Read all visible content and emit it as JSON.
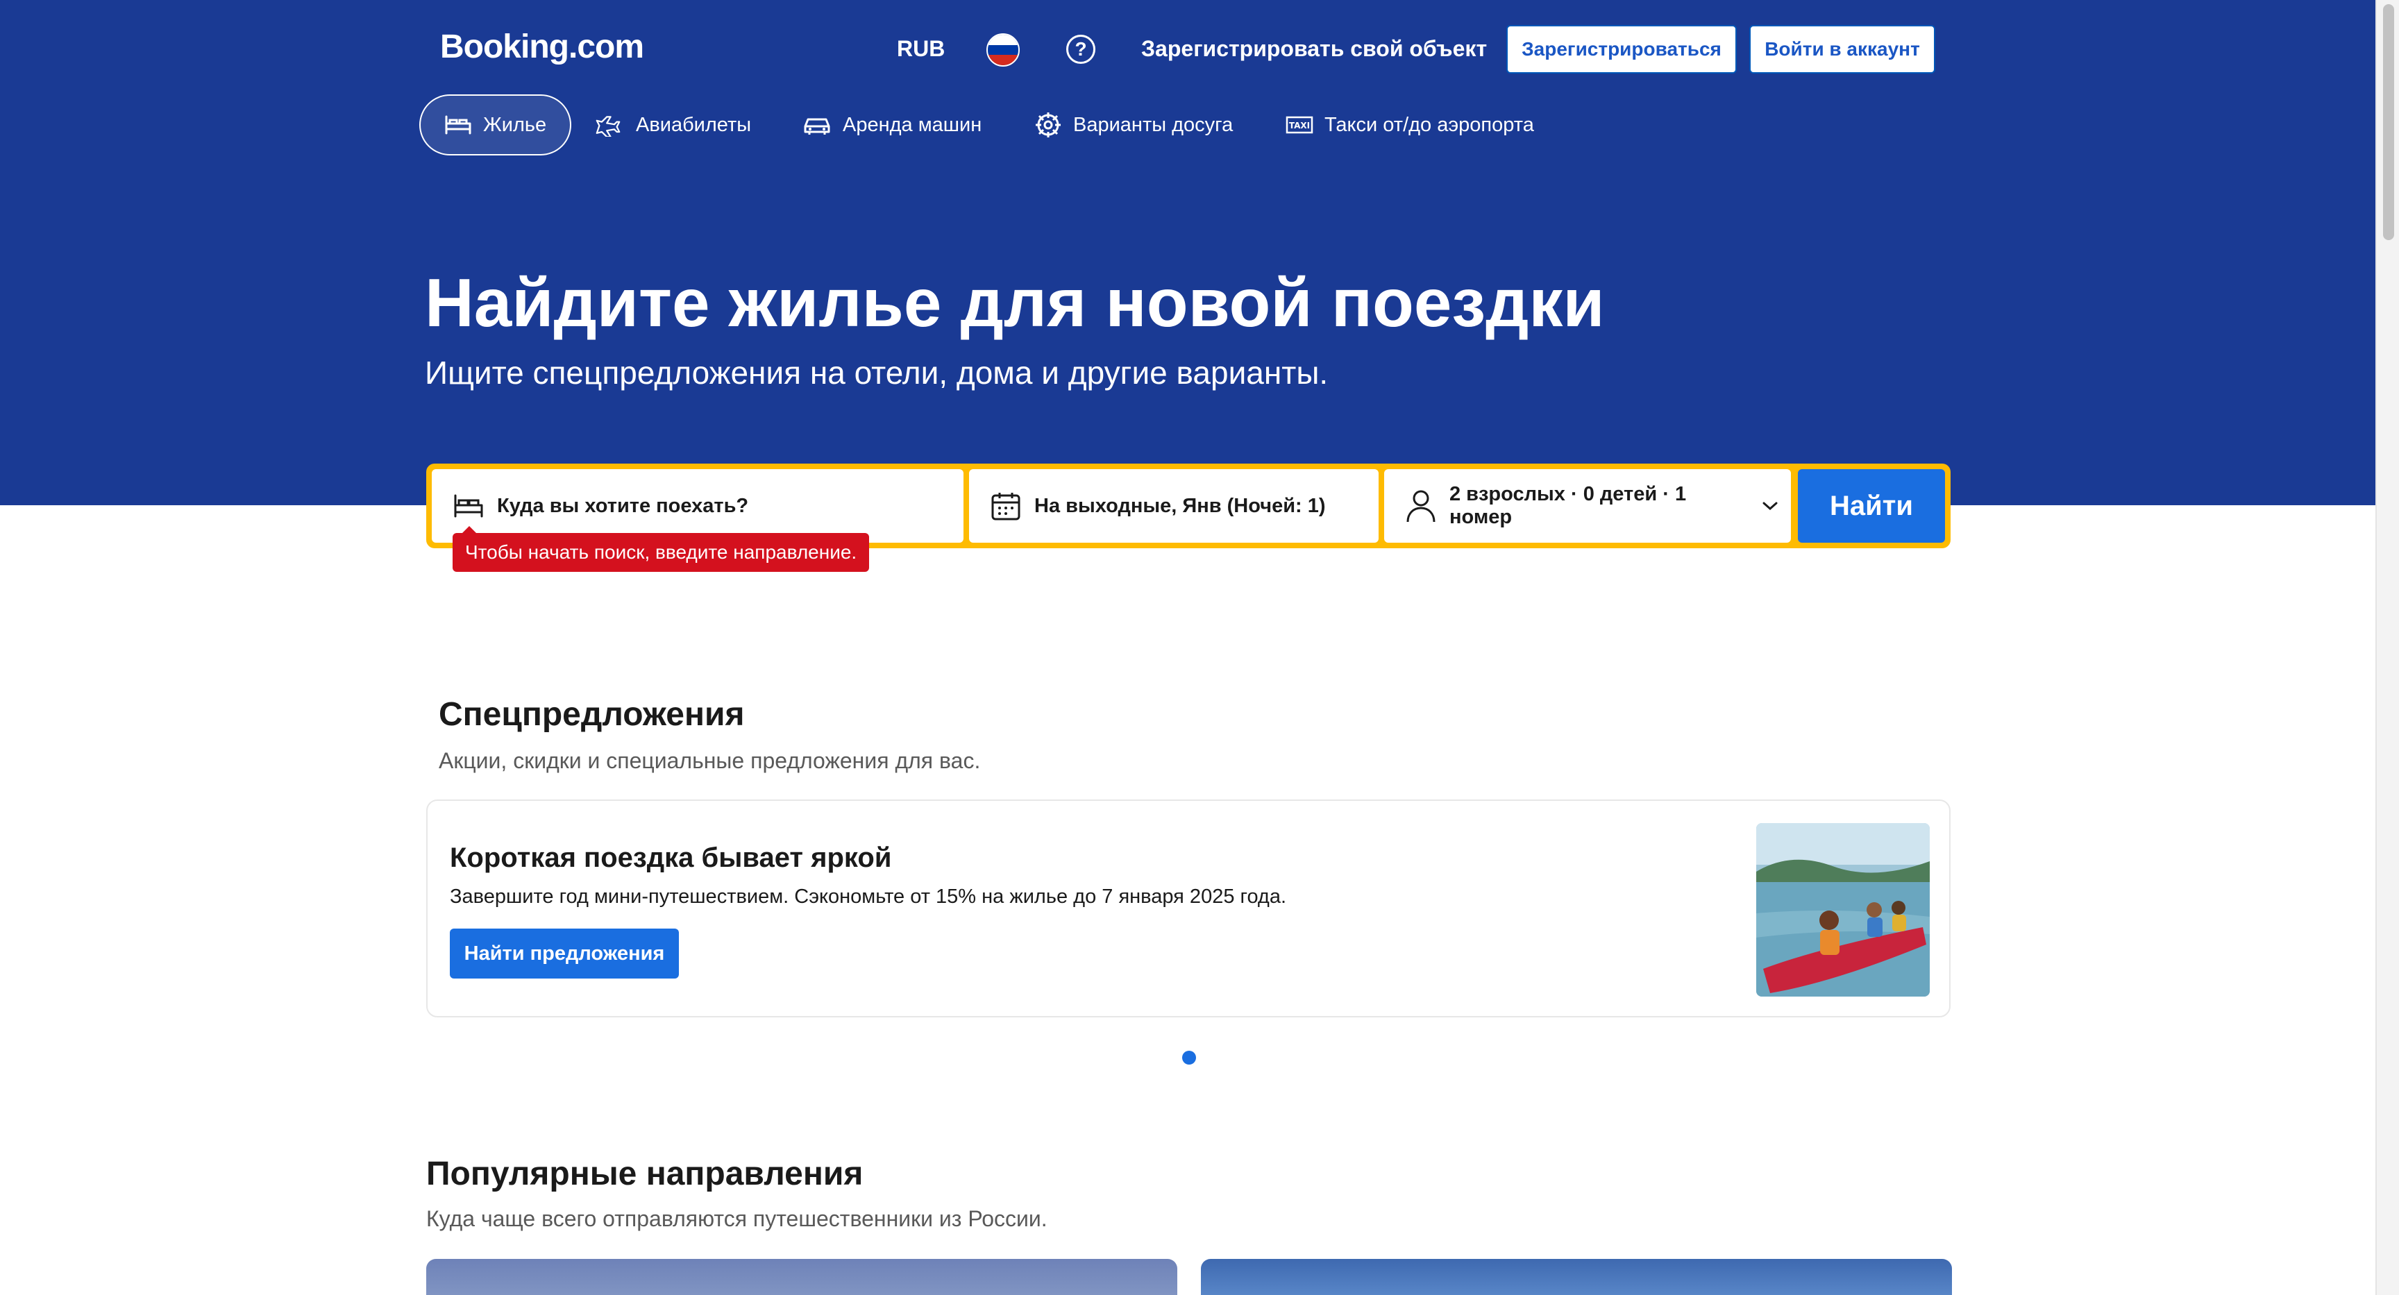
{
  "header": {
    "logo": "Booking.com",
    "currency": "RUB",
    "list_property": "Зарегистрировать свой объект",
    "register": "Зарегистрироваться",
    "login": "Войти в аккаунт"
  },
  "nav": {
    "tabs": [
      {
        "label": "Жилье",
        "icon": "bed-icon",
        "active": true
      },
      {
        "label": "Авиабилеты",
        "icon": "plane-icon"
      },
      {
        "label": "Аренда машин",
        "icon": "car-icon"
      },
      {
        "label": "Варианты досуга",
        "icon": "attractions-icon"
      },
      {
        "label": "Такси от/до аэропорта",
        "icon": "taxi-icon"
      }
    ]
  },
  "hero": {
    "title": "Найдите жилье для новой поездки",
    "subtitle": "Ищите спецпредложения на отели, дома и другие варианты."
  },
  "search": {
    "destination_placeholder": "Куда вы хотите поехать?",
    "dates": "На выходные, Янв (Ночей: 1)",
    "guests": "2 взрослых · 0 детей · 1 номер",
    "button": "Найти",
    "error": "Чтобы начать поиск, введите направление."
  },
  "offers": {
    "title": "Спецпредложения",
    "subtitle": "Акции, скидки и специальные предложения для вас.",
    "card_title": "Короткая поездка бывает яркой",
    "card_text": "Завершите год мини-путешествием. Сэкономьте от 15% на жилье до 7 января 2025 года.",
    "card_button": "Найти предложения"
  },
  "popular": {
    "title": "Популярные направления",
    "subtitle": "Куда чаще всего отправляются путешественники из России."
  },
  "colors": {
    "brand": "#1a3a94",
    "accent": "#1a6ee0",
    "search_border": "#febb02",
    "error": "#d4111e"
  }
}
